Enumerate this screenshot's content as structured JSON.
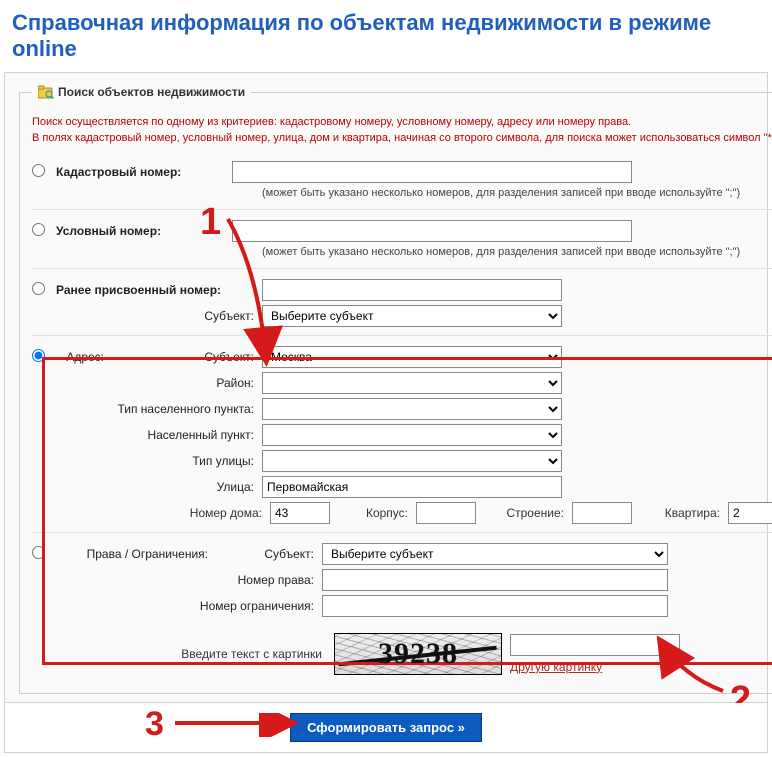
{
  "title": "Справочная информация по объектам недвижимости в режиме online",
  "legend": "Поиск объектов недвижимости",
  "hint1": "Поиск осуществляется по одному из критериев: кадастровому номеру, условному номеру, адресу или номеру права.",
  "hint2": "В полях кадастровый номер, условный номер, улица, дом и квартира, начиная со второго символа, для поиска может использоваться символ \"*\".",
  "cadastral": {
    "label": "Кадастровый номер:",
    "value": "",
    "note": "(может быть указано несколько номеров, для разделения записей при вводе используйте \";\")"
  },
  "conditional": {
    "label": "Условный номер:",
    "value": "",
    "note": "(может быть указано несколько номеров, для разделения записей при вводе используйте \";\")"
  },
  "prev_assigned": {
    "label": "Ранее присвоенный номер:",
    "value": "",
    "subject_label": "Субъект:",
    "subject_value": "Выберите субъект"
  },
  "address": {
    "label": "Адрес:",
    "subject_label": "Субъект:",
    "subject_value": "Москва",
    "district_label": "Район:",
    "district_value": "",
    "settlement_type_label": "Тип населенного пункта:",
    "settlement_type_value": "",
    "settlement_label": "Населенный пункт:",
    "settlement_value": "",
    "street_type_label": "Тип улицы:",
    "street_type_value": "",
    "street_label": "Улица:",
    "street_value": "Первомайская",
    "house_label": "Номер дома:",
    "house_value": "43",
    "korpus_label": "Корпус:",
    "korpus_value": "",
    "building_label": "Строение:",
    "building_value": "",
    "flat_label": "Квартира:",
    "flat_value": "2"
  },
  "rights": {
    "label": "Права / Ограничения:",
    "subject_label": "Субъект:",
    "subject_value": "Выберите субъект",
    "right_no_label": "Номер права:",
    "right_no_value": "",
    "restrict_no_label": "Номер ограничения:",
    "restrict_no_value": ""
  },
  "captcha": {
    "label": "Введите текст с картинки",
    "value": "39238",
    "input_value": "",
    "change_link": "Другую картинку"
  },
  "submit_label": "Сформировать запрос »",
  "ann": {
    "one": "1",
    "two": "2",
    "three": "3"
  }
}
